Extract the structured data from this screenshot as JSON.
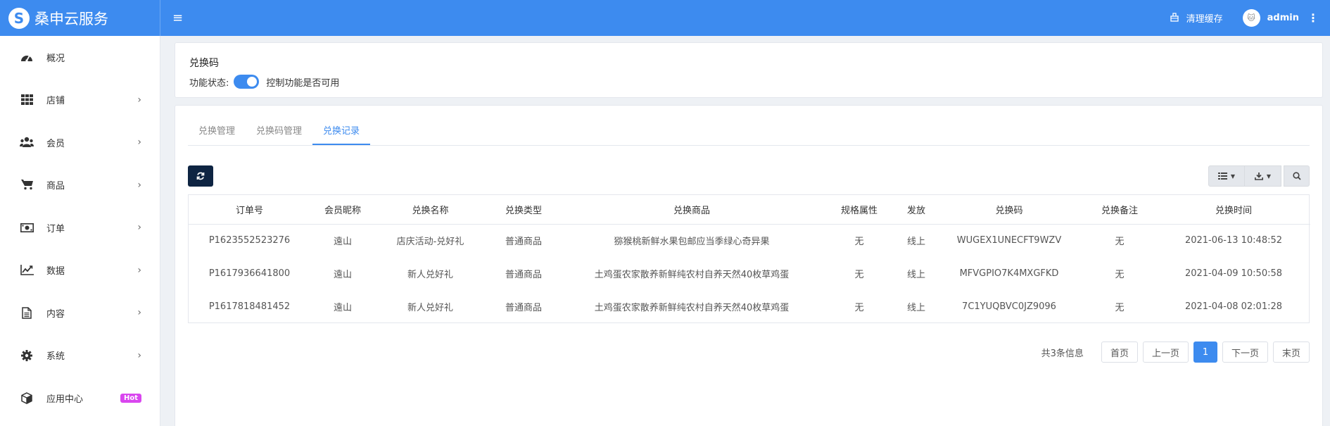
{
  "header": {
    "logo_letter": "S",
    "brand": "桑申云服务",
    "menu_toggle": "≡",
    "clear_cache": "清理缓存",
    "avatar_text": "🐱",
    "user": "admin"
  },
  "sidebar": {
    "items": [
      {
        "label": "概况",
        "icon": "dashboard-icon",
        "has_children": false
      },
      {
        "label": "店铺",
        "icon": "grid-icon",
        "has_children": true
      },
      {
        "label": "会员",
        "icon": "users-icon",
        "has_children": true
      },
      {
        "label": "商品",
        "icon": "cart-icon",
        "has_children": true
      },
      {
        "label": "订单",
        "icon": "money-icon",
        "has_children": true
      },
      {
        "label": "数据",
        "icon": "chart-icon",
        "has_children": true
      },
      {
        "label": "内容",
        "icon": "document-icon",
        "has_children": true
      },
      {
        "label": "系统",
        "icon": "gear-icon",
        "has_children": true
      },
      {
        "label": "应用中心",
        "icon": "cube-icon",
        "badge": "Hot"
      }
    ]
  },
  "feature": {
    "title": "兑换码",
    "status_label": "功能状态:",
    "enabled": true,
    "status_hint": "控制功能是否可用"
  },
  "tabs": [
    {
      "label": "兑换管理",
      "active": false
    },
    {
      "label": "兑换码管理",
      "active": false
    },
    {
      "label": "兑换记录",
      "active": true
    }
  ],
  "table": {
    "columns": [
      "订单号",
      "会员昵称",
      "兑换名称",
      "兑换类型",
      "兑换商品",
      "规格属性",
      "发放",
      "兑换码",
      "兑换备注",
      "兑换时间"
    ],
    "rows": [
      [
        "P1623552523276",
        "遠山",
        "店庆活动-兑好礼",
        "普通商品",
        "猕猴桃新鲜水果包邮应当季绿心奇异果",
        "无",
        "线上",
        "WUGEX1UNECFT9WZV",
        "无",
        "2021-06-13 10:48:52"
      ],
      [
        "P1617936641800",
        "遠山",
        "新人兑好礼",
        "普通商品",
        "土鸡蛋农家散养新鲜纯农村自养天然40枚草鸡蛋",
        "无",
        "线上",
        "MFVGPIO7K4MXGFKD",
        "无",
        "2021-04-09 10:50:58"
      ],
      [
        "P1617818481452",
        "遠山",
        "新人兑好礼",
        "普通商品",
        "土鸡蛋农家散养新鲜纯农村自养天然40枚草鸡蛋",
        "无",
        "线上",
        "7C1YUQBVC0JZ9096",
        "无",
        "2021-04-08 02:01:28"
      ]
    ]
  },
  "pagination": {
    "info": "共3条信息",
    "first": "首页",
    "prev": "上一页",
    "current": "1",
    "next": "下一页",
    "last": "末页"
  },
  "colors": {
    "primary": "#3d8bef",
    "refresh_button": "#0e2442",
    "hot_badge": "#d946ef"
  }
}
